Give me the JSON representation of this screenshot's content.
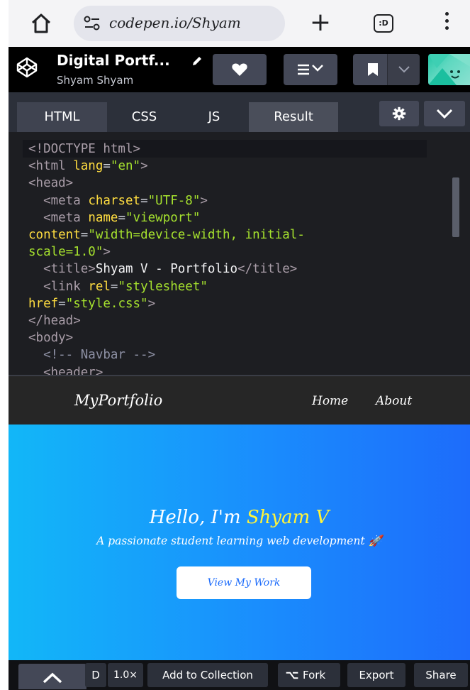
{
  "browser": {
    "url": "codepen.io/Shyam",
    "tabs_count": ":D",
    "icons": [
      "home-icon",
      "site-settings-icon",
      "new-tab-icon",
      "tab-switcher-icon",
      "more-menu-icon"
    ]
  },
  "pen": {
    "title": "Digital Portf...",
    "author": "Shyam Shyam",
    "icons": [
      "codepen-logo-icon",
      "edit-pencil-icon",
      "heart-icon",
      "layout-icon",
      "bookmark-icon",
      "chevron-down-icon"
    ]
  },
  "editor": {
    "tabs": [
      {
        "label": "HTML"
      },
      {
        "label": "CSS"
      },
      {
        "label": "JS"
      },
      {
        "label": "Result"
      }
    ],
    "code": {
      "line1": "<!DOCTYPE html>",
      "l2_open": "<html",
      "l2_attr": "lang",
      "l2_val": "\"en\"",
      "l2_close": ">",
      "l3": "<head>",
      "l4_open": "<meta",
      "l4_attr": "charset",
      "l4_val": "\"UTF-8\"",
      "l4_close": ">",
      "l5_open": "<meta",
      "l5_attr": "name",
      "l5_val": "\"viewport\"",
      "l6_attr": "content",
      "l6_val": "\"width=device-width, initial-",
      "l7_val": "scale=1.0\"",
      "l7_close": ">",
      "l8_open": "<title>",
      "l8_text": "Shyam V - Portfolio",
      "l8_close": "</title>",
      "l9_open": "<link",
      "l9_attr": "rel",
      "l9_val": "\"stylesheet\"",
      "l10_attr": "href",
      "l10_val": "\"style.css\"",
      "l10_close": ">",
      "l11": "</head>",
      "l12": "<body>",
      "l13": "<!-- Navbar -->",
      "l14": "<header>"
    },
    "error_badge": "!"
  },
  "preview": {
    "logo": "MyPortfolio",
    "nav_links": [
      "Home",
      "About"
    ],
    "hero_prefix": "Hello, I'm ",
    "hero_name": "Shyam V",
    "hero_subtitle": "A passionate student learning web development 🚀",
    "cta_button": "View My Work"
  },
  "footer": {
    "d_label": "D",
    "zoom": "1.0×",
    "add_collection": "Add to Collection",
    "fork": "Fork",
    "export": "Export",
    "share": "Share"
  },
  "colors": {
    "codepen_black": "#000000",
    "editor_bg": "#1d1e22",
    "tab_bar": "#2c303a",
    "button_gray": "#444857",
    "tag_color": "#a99da8",
    "attr_color": "#ffdd40",
    "string_color": "#a6e22e",
    "hero_gradient_start": "#12b7f8",
    "hero_gradient_end": "#1d6cfb",
    "highlight_yellow": "#fff43a",
    "error_red": "#e02a2a"
  }
}
